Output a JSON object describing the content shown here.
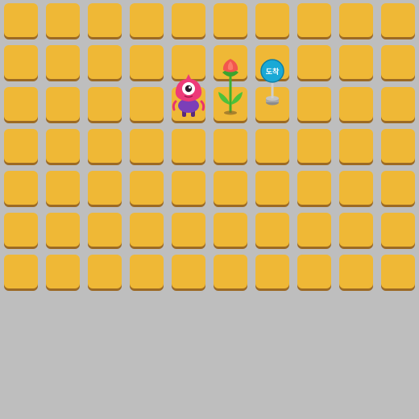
{
  "board": {
    "columns": 10,
    "rows": 7,
    "colors": {
      "background": "#bebebe",
      "tile": "#efb836",
      "tile_shadow": "#9c6a24"
    }
  },
  "monster": {
    "icon": "pink-one-eyed-monster-icon",
    "cell": {
      "row": 2,
      "col": 4
    }
  },
  "flower": {
    "icon": "red-tulip-flower-icon",
    "cell": {
      "row": 1,
      "col": 5
    }
  },
  "goal_sign": {
    "icon": "arrival-signpost-icon",
    "cell": {
      "row": 1,
      "col": 6
    },
    "label": "도착",
    "color": "#1aa9d6"
  }
}
